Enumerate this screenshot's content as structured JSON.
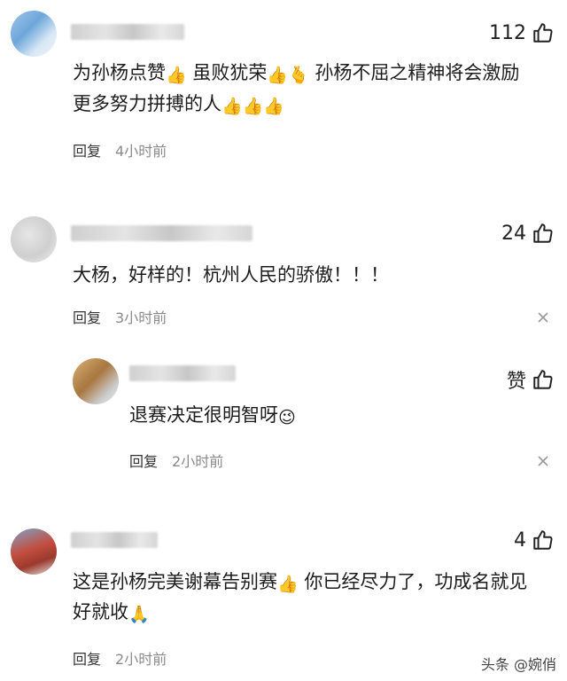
{
  "comments": [
    {
      "likes": "112",
      "text_lines": [
        "为孙杨点赞",
        "虽败犹荣",
        "孙杨不屈之精神将会激励",
        "更多努力拼搏的人"
      ],
      "reply_label": "回复",
      "time": "4小时前"
    },
    {
      "likes": "24",
      "text": "大杨，好样的！杭州人民的骄傲！！！",
      "reply_label": "回复",
      "time": "3小时前"
    },
    {
      "likes": "赞",
      "text": "退赛决定很明智呀",
      "reply_label": "回复",
      "time": "2小时前"
    },
    {
      "likes": "4",
      "text_lines": [
        "这是孙杨完美谢幕告别赛",
        "你已经尽力了，功成名就见",
        "好就收"
      ],
      "reply_label": "回复",
      "time": "2小时前"
    }
  ],
  "icons": {
    "thumb": "thumbs-up-outline-icon",
    "close": "close-x-icon",
    "emoji_thumb": "👍",
    "emoji_heart_hand": "🫰",
    "emoji_wink": "😉",
    "emoji_pray": "🙏"
  },
  "watermark": "头条 @婉俏",
  "colors": {
    "time": "#8a8a8a",
    "text": "#1c1c1c"
  }
}
